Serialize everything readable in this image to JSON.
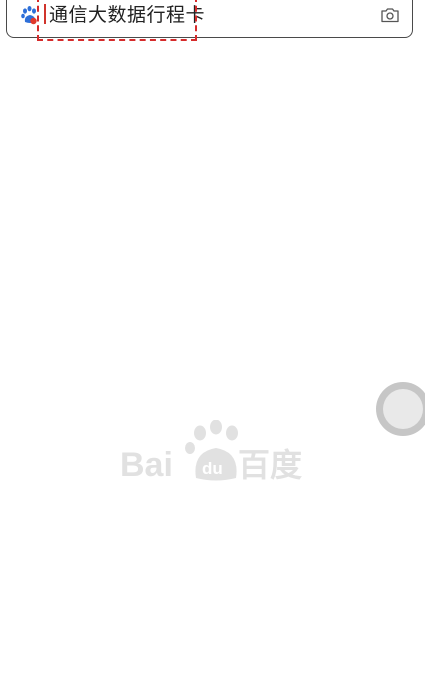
{
  "search": {
    "query": "通信大数据行程卡"
  },
  "icons": {
    "left": "baidu-paw-icon",
    "right": "camera-icon",
    "floating": "floating-circle-button"
  },
  "watermark": {
    "brand_latin": "Bai",
    "brand_du": "du",
    "brand_cn": "百度"
  },
  "colors": {
    "highlight": "#d62b2b",
    "paw_blue": "#2e6fd8",
    "paw_red": "#e0392b",
    "watermark": "#e1e1e1"
  }
}
